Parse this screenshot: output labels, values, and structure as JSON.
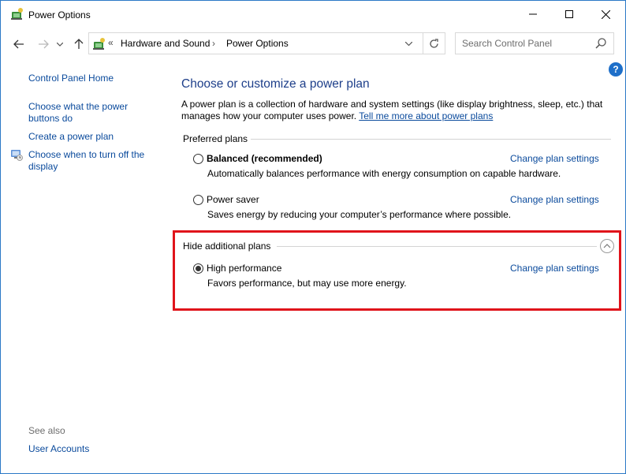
{
  "window": {
    "title": "Power Options"
  },
  "address_bar": {
    "separator": "«",
    "crumbs": [
      "Hardware and Sound",
      "Power Options"
    ],
    "arrow": "›"
  },
  "search": {
    "placeholder": "Search Control Panel"
  },
  "help": {
    "label": "?"
  },
  "left_pane": {
    "home": "Control Panel Home",
    "items": [
      "Choose what the power buttons do",
      "Create a power plan",
      "Choose when to turn off the display"
    ],
    "see_also_label": "See also",
    "see_also_items": [
      "User Accounts"
    ]
  },
  "main": {
    "title": "Choose or customize a power plan",
    "intro_text": "A power plan is a collection of hardware and system settings (like display brightness, sleep, etc.) that manages how your computer uses power. ",
    "intro_link": "Tell me more about power plans",
    "preferred_heading": "Preferred plans",
    "hide_heading": "Hide additional plans",
    "plans": [
      {
        "name": "Balanced (recommended)",
        "description": "Automatically balances performance with energy consumption on capable hardware.",
        "link": "Change plan settings",
        "selected": false
      },
      {
        "name": "Power saver",
        "description": "Saves energy by reducing your computer’s performance where possible.",
        "link": "Change plan settings",
        "selected": false
      },
      {
        "name": "High performance",
        "description": "Favors performance, but may use more energy.",
        "link": "Change plan settings",
        "selected": true
      }
    ]
  },
  "colors": {
    "accent": "#1e6fc9",
    "link": "#0a4a9c",
    "title": "#1e3f8a",
    "highlight": "#e0141b"
  }
}
